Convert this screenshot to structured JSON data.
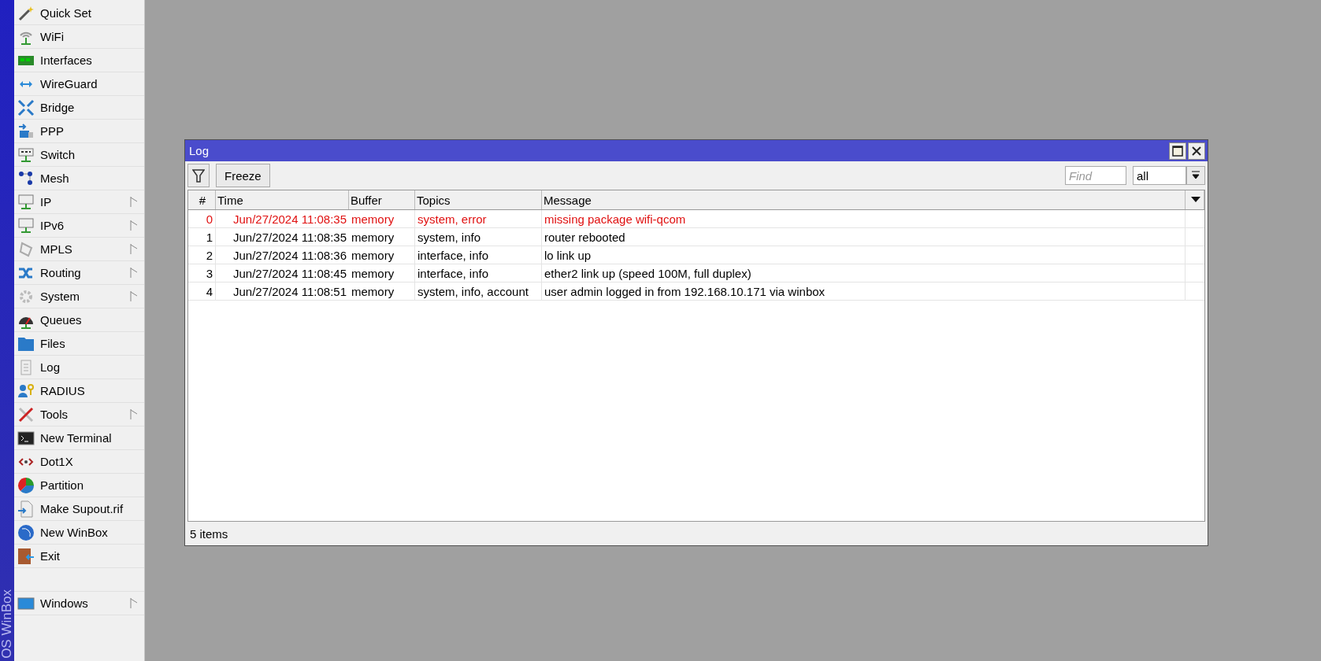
{
  "sidebar": {
    "brand": "OS WinBox",
    "items": [
      {
        "label": "Quick Set",
        "submenu": false
      },
      {
        "label": "WiFi",
        "submenu": false
      },
      {
        "label": "Interfaces",
        "submenu": false
      },
      {
        "label": "WireGuard",
        "submenu": false
      },
      {
        "label": "Bridge",
        "submenu": false
      },
      {
        "label": "PPP",
        "submenu": false
      },
      {
        "label": "Switch",
        "submenu": false
      },
      {
        "label": "Mesh",
        "submenu": false
      },
      {
        "label": "IP",
        "submenu": true
      },
      {
        "label": "IPv6",
        "submenu": true
      },
      {
        "label": "MPLS",
        "submenu": true
      },
      {
        "label": "Routing",
        "submenu": true
      },
      {
        "label": "System",
        "submenu": true
      },
      {
        "label": "Queues",
        "submenu": false
      },
      {
        "label": "Files",
        "submenu": false
      },
      {
        "label": "Log",
        "submenu": false
      },
      {
        "label": "RADIUS",
        "submenu": false
      },
      {
        "label": "Tools",
        "submenu": true
      },
      {
        "label": "New Terminal",
        "submenu": false
      },
      {
        "label": "Dot1X",
        "submenu": false
      },
      {
        "label": "Partition",
        "submenu": false
      },
      {
        "label": "Make Supout.rif",
        "submenu": false
      },
      {
        "label": "New WinBox",
        "submenu": false
      },
      {
        "label": "Exit",
        "submenu": false
      }
    ],
    "bottom_items": [
      {
        "label": "Windows",
        "submenu": true
      }
    ]
  },
  "log_window": {
    "title": "Log",
    "toolbar": {
      "freeze_button": "Freeze",
      "find": {
        "placeholder": "Find"
      },
      "filter_value": "all"
    },
    "table": {
      "columns": [
        "#",
        "Time",
        "Buffer",
        "Topics",
        "Message"
      ],
      "rows": [
        {
          "index": "0",
          "time": "Jun/27/2024 11:08:35",
          "buffer": "memory",
          "topics": "system, error",
          "message": "missing package wifi-qcom",
          "error": true
        },
        {
          "index": "1",
          "time": "Jun/27/2024 11:08:35",
          "buffer": "memory",
          "topics": "system, info",
          "message": "router rebooted",
          "error": false
        },
        {
          "index": "2",
          "time": "Jun/27/2024 11:08:36",
          "buffer": "memory",
          "topics": "interface, info",
          "message": "lo link up",
          "error": false
        },
        {
          "index": "3",
          "time": "Jun/27/2024 11:08:45",
          "buffer": "memory",
          "topics": "interface, info",
          "message": "ether2 link up (speed 100M, full duplex)",
          "error": false
        },
        {
          "index": "4",
          "time": "Jun/27/2024 11:08:51",
          "buffer": "memory",
          "topics": "system, info, account",
          "message": "user admin logged in from 192.168.10.171 via winbox",
          "error": false
        }
      ]
    },
    "status": "5 items"
  }
}
